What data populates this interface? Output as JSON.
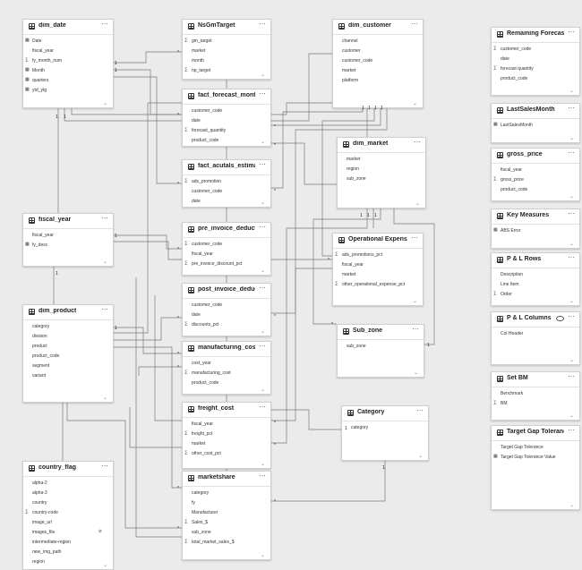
{
  "tables": [
    {
      "name": "dim_date",
      "fields": [
        {
          "t": "Date",
          "i": "cal"
        },
        {
          "t": "fiscal_year"
        },
        {
          "t": "fy_month_num",
          "i": "sum"
        },
        {
          "t": "Month",
          "i": "cal"
        },
        {
          "t": "quarters",
          "i": "cal"
        },
        {
          "t": "ytd_ytg",
          "i": "cal"
        }
      ]
    },
    {
      "name": "NsGmTarget",
      "fields": [
        {
          "t": "gm_target",
          "i": "sum"
        },
        {
          "t": "market"
        },
        {
          "t": "month"
        },
        {
          "t": "np_target",
          "i": "sum"
        }
      ]
    },
    {
      "name": "dim_customer",
      "fields": [
        {
          "t": "channel"
        },
        {
          "t": "customer"
        },
        {
          "t": "customer_code"
        },
        {
          "t": "market"
        },
        {
          "t": "platform"
        }
      ]
    },
    {
      "name": "Remaining Forecast Mo...",
      "fields": [
        {
          "t": "customer_code",
          "i": "sum"
        },
        {
          "t": "date"
        },
        {
          "t": "forecast quantity",
          "i": "sum"
        },
        {
          "t": "product_code"
        }
      ]
    },
    {
      "name": "fact_forecast_monthly",
      "fields": [
        {
          "t": "customer_code"
        },
        {
          "t": "date"
        },
        {
          "t": "forecast_quantity",
          "i": "sum"
        },
        {
          "t": "product_code"
        }
      ]
    },
    {
      "name": "LastSalesMonth",
      "fields": [
        {
          "t": "LastSalesMonth",
          "i": "cal"
        }
      ]
    },
    {
      "name": "fact_acutals_estimates",
      "fields": [
        {
          "t": "ads_promotion",
          "i": "sum"
        },
        {
          "t": "customer_code"
        },
        {
          "t": "date"
        }
      ]
    },
    {
      "name": "dim_market",
      "fields": [
        {
          "t": "market"
        },
        {
          "t": "region"
        },
        {
          "t": "sub_zone"
        }
      ]
    },
    {
      "name": "gross_price",
      "fields": [
        {
          "t": "fiscal_year"
        },
        {
          "t": "gross_price",
          "i": "sum"
        },
        {
          "t": "product_code"
        }
      ]
    },
    {
      "name": "fiscal_year",
      "fields": [
        {
          "t": "fiscal_year"
        },
        {
          "t": "fy_desc",
          "i": "cal"
        }
      ]
    },
    {
      "name": "pre_invoice_deductions",
      "fields": [
        {
          "t": "customer_code",
          "i": "sum"
        },
        {
          "t": "fiscal_year"
        },
        {
          "t": "pre_invoice_discount_pct",
          "i": "sum"
        }
      ]
    },
    {
      "name": "Key Measures",
      "fields": [
        {
          "t": "ABS Error",
          "i": "cal"
        }
      ]
    },
    {
      "name": "Operational Expense",
      "fields": [
        {
          "t": "ads_promotions_pct",
          "i": "sum"
        },
        {
          "t": "fiscal_year"
        },
        {
          "t": "market"
        },
        {
          "t": "other_operational_expense_pct",
          "i": "sum"
        }
      ]
    },
    {
      "name": "P & L Rows",
      "fields": [
        {
          "t": "Description"
        },
        {
          "t": "Line Item"
        },
        {
          "t": "Order",
          "i": "sum"
        }
      ]
    },
    {
      "name": "post_invoice_deductions",
      "fields": [
        {
          "t": "customer_code"
        },
        {
          "t": "date"
        },
        {
          "t": "discounts_pct",
          "i": "sum"
        }
      ]
    },
    {
      "name": "dim_product",
      "fields": [
        {
          "t": "category"
        },
        {
          "t": "division"
        },
        {
          "t": "product"
        },
        {
          "t": "product_code"
        },
        {
          "t": "segment"
        },
        {
          "t": "variant"
        }
      ]
    },
    {
      "name": "P & L Columns",
      "fields": [
        {
          "t": "Col Header"
        }
      ]
    },
    {
      "name": "Sub_zone",
      "fields": [
        {
          "t": "sub_zone"
        }
      ]
    },
    {
      "name": "manufacturing_cost",
      "fields": [
        {
          "t": "cost_year"
        },
        {
          "t": "manufacturing_cost",
          "i": "sum"
        },
        {
          "t": "product_code"
        }
      ]
    },
    {
      "name": "Set BM",
      "fields": [
        {
          "t": "Benchmark"
        },
        {
          "t": "BM",
          "i": "sum"
        }
      ]
    },
    {
      "name": "freight_cost",
      "fields": [
        {
          "t": "fiscal_year"
        },
        {
          "t": "freight_pct",
          "i": "sum"
        },
        {
          "t": "market"
        },
        {
          "t": "other_cost_pct",
          "i": "sum"
        }
      ]
    },
    {
      "name": "Category",
      "fields": [
        {
          "t": "category"
        }
      ]
    },
    {
      "name": "Target Gap Tolerance",
      "fields": [
        {
          "t": "Target Gap Tolerance"
        },
        {
          "t": "Target Gap Tolerance Value",
          "i": "cal"
        }
      ]
    },
    {
      "name": "country_flag",
      "fields": [
        {
          "t": "alpha-2"
        },
        {
          "t": "alpha-3"
        },
        {
          "t": "country"
        },
        {
          "t": "country-code",
          "i": "sum"
        },
        {
          "t": "image_url"
        },
        {
          "t": "images_file",
          "x": "hidden"
        },
        {
          "t": "intermediate-region"
        },
        {
          "t": "new_img_path"
        },
        {
          "t": "region"
        }
      ]
    },
    {
      "name": "marketshare",
      "fields": [
        {
          "t": "category"
        },
        {
          "t": "fy"
        },
        {
          "t": "Manufacturer"
        },
        {
          "t": "Sales_$",
          "i": "sum"
        },
        {
          "t": "sub_zone"
        },
        {
          "t": "total_market_sales_$",
          "i": "sum"
        }
      ]
    }
  ],
  "cardinality": {
    "one": "1",
    "many": "*"
  },
  "icons": {
    "sum": "∑",
    "cal": "▦",
    "hidden": "⊘",
    "more": "···",
    "expand": "⌄",
    "eye": "👁"
  },
  "colors": {
    "background": "#ebebeb",
    "card": "#ffffff",
    "line": "#7a7a7a"
  }
}
